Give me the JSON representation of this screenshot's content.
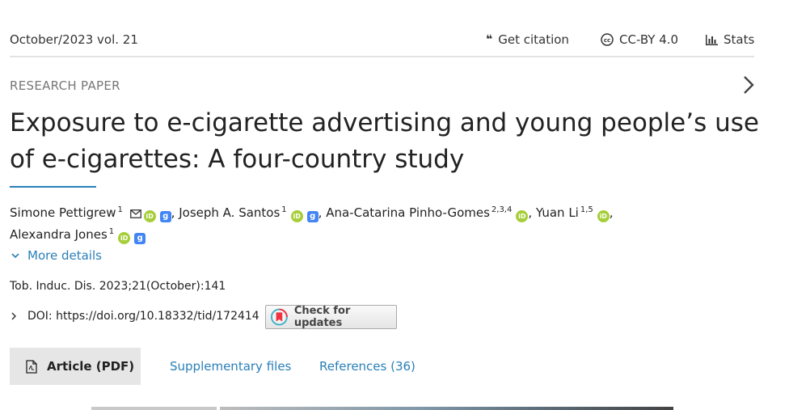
{
  "issue": "October/2023 vol. 21",
  "toolbar": {
    "citation": "Get citation",
    "license": "CC-BY 4.0",
    "stats": "Stats"
  },
  "article": {
    "type": "RESEARCH PAPER",
    "title": "Exposure to e-cigarette advertising and young people’s use of e-cigarettes: A four-country study",
    "authors": [
      {
        "name": "Simone Pettigrew",
        "aff": "1"
      },
      {
        "name": "Joseph A. Santos",
        "aff": "1"
      },
      {
        "name": "Ana-Catarina Pinho-Gomes",
        "aff": "2,3,4"
      },
      {
        "name": "Yuan Li",
        "aff": "1,5"
      },
      {
        "name": "Alexandra Jones",
        "aff": "1"
      }
    ],
    "more_details": "More details",
    "citation": "Tob. Induc. Dis. 2023;21(October):141",
    "doi": "DOI: https://doi.org/10.18332/tid/172414",
    "check_updates": "Check for updates"
  },
  "tabs": {
    "pdf": "Article (PDF)",
    "supplementary": "Supplementary files",
    "references": "References (36)"
  },
  "icons": {
    "citation": "quote-icon",
    "license": "creative-commons-icon",
    "stats": "bar-chart-icon",
    "orcid": "orcid-icon",
    "scholar": "google-scholar-icon",
    "email": "envelope-icon"
  },
  "colors": {
    "link": "#2a7fb8",
    "orcid": "#a6ce39",
    "scholar": "#4285f4"
  }
}
